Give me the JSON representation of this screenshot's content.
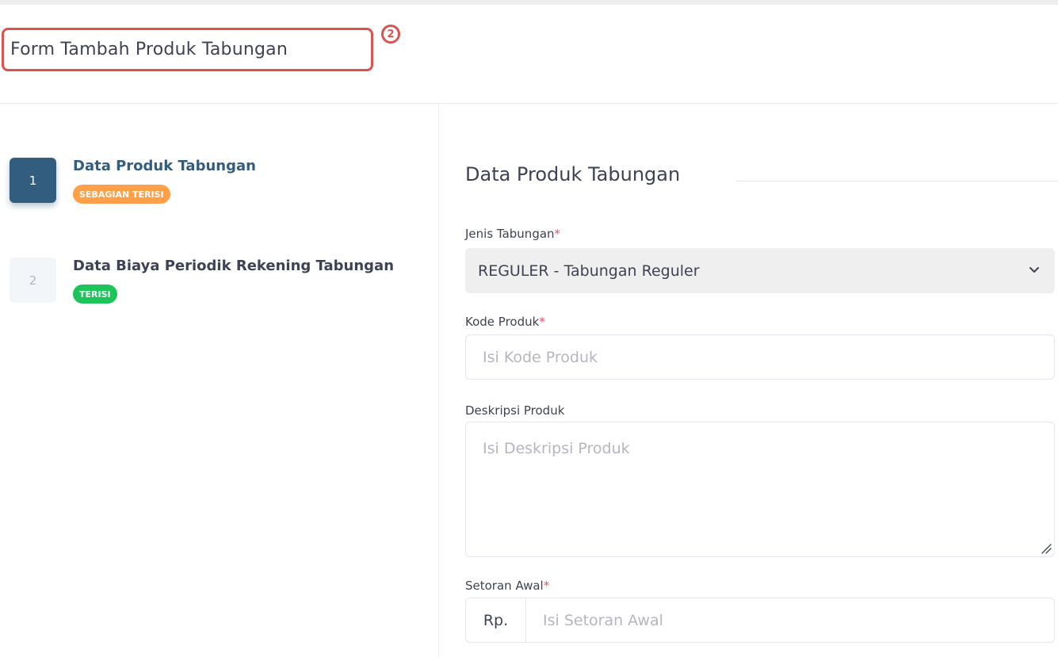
{
  "page": {
    "title": "Form Tambah Produk Tabungan",
    "annotation_marker": "2"
  },
  "stepper": {
    "steps": [
      {
        "number": "1",
        "title": "Data Produk Tabungan",
        "badge": "SEBAGIAN TERISI",
        "state": "active"
      },
      {
        "number": "2",
        "title": "Data Biaya Periodik Rekening Tabungan",
        "badge": "TERISI",
        "state": "inactive"
      }
    ]
  },
  "form": {
    "section_title": "Data Produk Tabungan",
    "jenis_tabungan": {
      "label": "Jenis Tabungan",
      "required_mark": "*",
      "value": "REGULER - Tabungan Reguler"
    },
    "kode_produk": {
      "label": "Kode Produk",
      "required_mark": "*",
      "placeholder": "Isi Kode Produk"
    },
    "deskripsi_produk": {
      "label": "Deskripsi Produk",
      "placeholder": "Isi Deskripsi Produk"
    },
    "setoran_awal": {
      "label": "Setoran Awal",
      "required_mark": "*",
      "prefix": "Rp.",
      "placeholder": "Isi Setoran Awal"
    }
  },
  "colors": {
    "primary": "#335d7e",
    "warning_badge": "#ffa048",
    "success_badge": "#1bc55a",
    "annotation": "#d9534f",
    "required": "#f64e60"
  }
}
